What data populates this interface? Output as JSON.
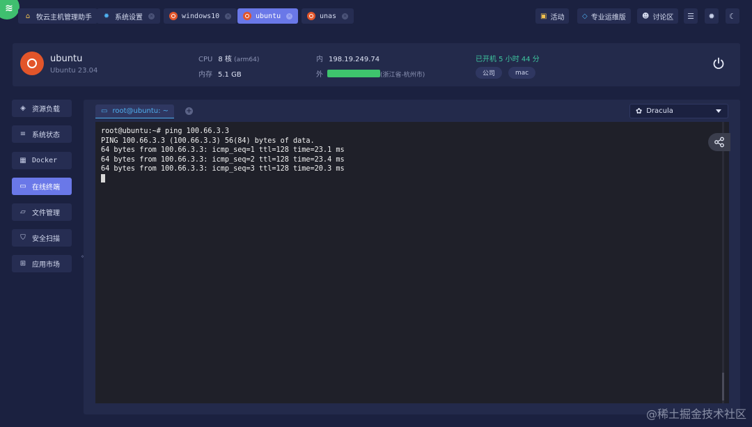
{
  "app": {
    "tabs": [
      {
        "label": "牧云主机管理助手",
        "icon": "home-icon"
      },
      {
        "label": "系统设置",
        "icon": "gear-icon"
      },
      {
        "label": "windows10",
        "icon": "ubuntu-icon"
      },
      {
        "label": "ubuntu",
        "icon": "ubuntu-icon"
      },
      {
        "label": "unas",
        "icon": "ubuntu-icon"
      }
    ],
    "active_tab": "ubuntu",
    "right_buttons": [
      {
        "label": "活动",
        "icon": "gift-icon"
      },
      {
        "label": "专业运维版",
        "icon": "diamond-icon"
      },
      {
        "label": "讨论区",
        "icon": "users-icon"
      }
    ]
  },
  "host": {
    "name": "ubuntu",
    "os": "Ubuntu 23.04",
    "cpu_label": "CPU",
    "cpu_value": "8 核",
    "cpu_arch": "(arm64)",
    "mem_label": "内存",
    "mem_value": "5.1 GB",
    "inner_label": "内",
    "inner_ip": "198.19.249.74",
    "outer_label": "外",
    "outer_location": "(浙江省-杭州市)",
    "uptime": "已开机 5 小时 44 分",
    "tags": [
      "公司",
      "mac"
    ]
  },
  "sidebar": {
    "items": [
      {
        "label": "资源负载",
        "icon": "layers-icon"
      },
      {
        "label": "系统状态",
        "icon": "list-icon"
      },
      {
        "label": "Docker",
        "icon": "docker-icon"
      },
      {
        "label": "在线终端",
        "icon": "terminal-icon"
      },
      {
        "label": "文件管理",
        "icon": "folder-icon"
      },
      {
        "label": "安全扫描",
        "icon": "shield-icon"
      },
      {
        "label": "应用市场",
        "icon": "apps-icon"
      }
    ],
    "active": "在线终端"
  },
  "terminal": {
    "tab_label": "root@ubuntu: ~",
    "theme": "Dracula",
    "lines": [
      "root@ubuntu:~# ping 100.66.3.3",
      "PING 100.66.3.3 (100.66.3.3) 56(84) bytes of data.",
      "64 bytes from 100.66.3.3: icmp_seq=1 ttl=128 time=23.1 ms",
      "64 bytes from 100.66.3.3: icmp_seq=2 ttl=128 time=23.4 ms",
      "64 bytes from 100.66.3.3: icmp_seq=3 ttl=128 time=20.3 ms"
    ]
  },
  "watermark": "@稀土掘金技术社区",
  "colors": {
    "background": "#1b2140",
    "panel": "#232a4b",
    "accent": "#6a78e8",
    "ubuntu": "#e2552a",
    "uptime": "#3ec8a0",
    "terminal_bg": "#1f2029"
  }
}
